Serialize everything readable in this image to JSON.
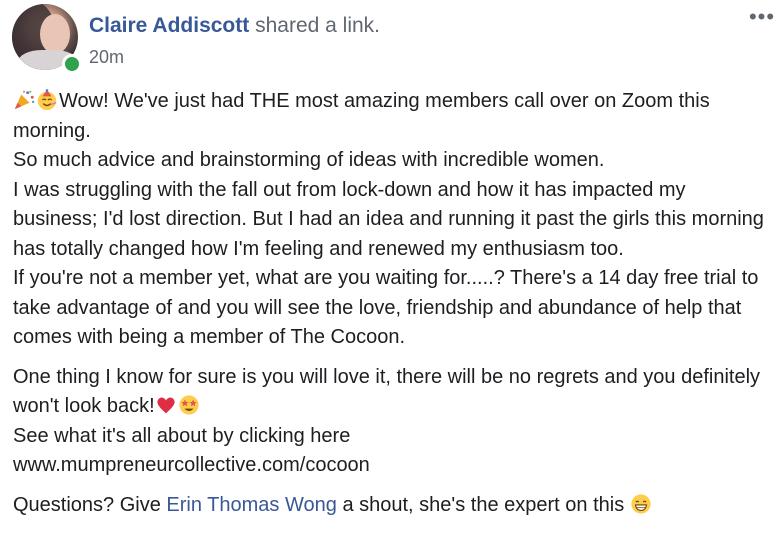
{
  "post": {
    "author_name": "Claire Addiscott",
    "action_text": "shared a link.",
    "timestamp": "20m",
    "more_icon": "•••",
    "paragraphs": {
      "p1": "Wow! We've just had THE most amazing members call over on Zoom this morning.",
      "p2": "So much advice and brainstorming of ideas with incredible women.",
      "p3": "I was struggling with the fall out from lock-down and how it has impacted my business; I'd lost direction. But I had an idea and running it past the girls this morning has totally changed how I'm feeling and renewed my enthusiasm too.",
      "p4": "If you're not a member yet, what are you waiting for.....? There's a 14 day free trial to take advantage of and you will see the love, friendship and abundance of help that comes with being a member of The Cocoon.",
      "p5": "One thing I know for sure is you will love it, there will be no regrets and you definitely won't look back!",
      "p6": "See what it's all about by clicking here",
      "p7": "www.mumpreneurcollective.com/cocoon",
      "p8_before": "Questions? Give",
      "p8_mention": "Erin Thomas Wong",
      "p8_after": "a shout, she's the expert on this"
    },
    "icons": {
      "party": "party-popper-icon",
      "partying_face": "partying-face-icon",
      "heart": "red-heart-icon",
      "star_struck": "star-struck-icon",
      "grin": "grinning-face-icon"
    },
    "colors": {
      "author": "#385898",
      "meta": "#606770",
      "text": "#1c1e21",
      "online": "#31a24c"
    }
  }
}
